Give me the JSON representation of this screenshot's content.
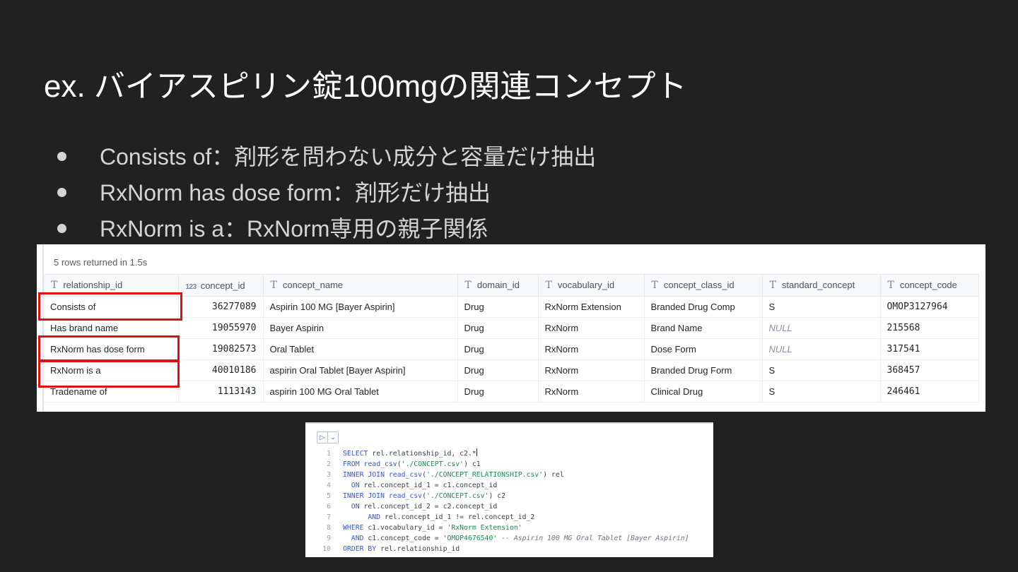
{
  "slide": {
    "title": "ex. バイアスピリン錠100mgの関連コンセプト",
    "bullets": [
      "Consists of：剤形を問わない成分と容量だけ抽出",
      "RxNorm has dose form：剤形だけ抽出",
      "RxNorm is a：RxNorm専用の親子関係"
    ]
  },
  "result": {
    "rows_returned": "5 rows returned in 1.5s",
    "columns": [
      {
        "type_icon": "T",
        "name": "relationship_id"
      },
      {
        "type_icon": "123",
        "name": "concept_id"
      },
      {
        "type_icon": "T",
        "name": "concept_name"
      },
      {
        "type_icon": "T",
        "name": "domain_id"
      },
      {
        "type_icon": "T",
        "name": "vocabulary_id"
      },
      {
        "type_icon": "T",
        "name": "concept_class_id"
      },
      {
        "type_icon": "T",
        "name": "standard_concept"
      },
      {
        "type_icon": "T",
        "name": "concept_code"
      }
    ],
    "rows": [
      {
        "relationship_id": "Consists of",
        "concept_id": "36277089",
        "concept_name": "Aspirin 100 MG [Bayer Aspirin]",
        "domain_id": "Drug",
        "vocabulary_id": "RxNorm Extension",
        "concept_class_id": "Branded Drug Comp",
        "standard_concept": "S",
        "concept_code": "OMOP3127964"
      },
      {
        "relationship_id": "Has brand name",
        "concept_id": "19055970",
        "concept_name": "Bayer Aspirin",
        "domain_id": "Drug",
        "vocabulary_id": "RxNorm",
        "concept_class_id": "Brand Name",
        "standard_concept": "NULL",
        "concept_code": "215568"
      },
      {
        "relationship_id": "RxNorm has dose form",
        "concept_id": "19082573",
        "concept_name": "Oral Tablet",
        "domain_id": "Drug",
        "vocabulary_id": "RxNorm",
        "concept_class_id": "Dose Form",
        "standard_concept": "NULL",
        "concept_code": "317541"
      },
      {
        "relationship_id": "RxNorm is a",
        "concept_id": "40010186",
        "concept_name": "aspirin Oral Tablet [Bayer Aspirin]",
        "domain_id": "Drug",
        "vocabulary_id": "RxNorm",
        "concept_class_id": "Branded Drug Form",
        "standard_concept": "S",
        "concept_code": "368457"
      },
      {
        "relationship_id": "Tradename of",
        "concept_id": "1113143",
        "concept_name": "aspirin 100 MG Oral Tablet",
        "domain_id": "Drug",
        "vocabulary_id": "RxNorm",
        "concept_class_id": "Clinical Drug",
        "standard_concept": "S",
        "concept_code": "246461"
      }
    ]
  },
  "sql_editor": {
    "run_icon": "run-triangle-icon",
    "dropdown_icon": "chevron-down-icon",
    "lines": [
      {
        "n": "1",
        "tokens": [
          [
            "kw",
            "SELECT"
          ],
          [
            "",
            "rel.relationship_id, c2.*"
          ]
        ],
        "caret": true
      },
      {
        "n": "2",
        "tokens": [
          [
            "kw",
            "FROM"
          ],
          [
            "",
            ""
          ],
          [
            "fn",
            "read_csv"
          ],
          [
            "",
            "("
          ],
          [
            "str",
            "'./CONCEPT.csv'"
          ],
          [
            "",
            ") c1"
          ]
        ]
      },
      {
        "n": "3",
        "tokens": [
          [
            "kw",
            "INNER JOIN"
          ],
          [
            "",
            ""
          ],
          [
            "fn",
            "read_csv"
          ],
          [
            "",
            "("
          ],
          [
            "str",
            "'./CONCEPT_RELATIONSHIP.csv'"
          ],
          [
            "",
            ") rel"
          ]
        ]
      },
      {
        "n": "4",
        "tokens": [
          [
            "",
            "  "
          ],
          [
            "kw",
            "ON"
          ],
          [
            "",
            "rel.concept_id_1 = c1.concept_id"
          ]
        ]
      },
      {
        "n": "5",
        "tokens": [
          [
            "kw",
            "INNER JOIN"
          ],
          [
            "",
            ""
          ],
          [
            "fn",
            "read_csv"
          ],
          [
            "",
            "("
          ],
          [
            "str",
            "'./CONCEPT.csv'"
          ],
          [
            "",
            ") c2"
          ]
        ]
      },
      {
        "n": "6",
        "tokens": [
          [
            "",
            "  "
          ],
          [
            "kw",
            "ON"
          ],
          [
            "",
            "rel.concept_id_2 = c2.concept_id"
          ]
        ]
      },
      {
        "n": "7",
        "tokens": [
          [
            "",
            "      "
          ],
          [
            "kw",
            "AND"
          ],
          [
            "",
            "rel.concept_id_1 != rel.concept_id_2"
          ]
        ]
      },
      {
        "n": "8",
        "tokens": [
          [
            "kw",
            "WHERE"
          ],
          [
            "",
            "c1.vocabulary_id = "
          ],
          [
            "str",
            "'RxNorm Extension'"
          ]
        ]
      },
      {
        "n": "9",
        "tokens": [
          [
            "",
            "  "
          ],
          [
            "kw",
            "AND"
          ],
          [
            "",
            "c1.concept_code = "
          ],
          [
            "str",
            "'OMOP4676540'"
          ],
          [
            "",
            " "
          ],
          [
            "cmt",
            "-- Aspirin 100 MG Oral Tablet [Bayer Aspirin]"
          ]
        ]
      },
      {
        "n": "10",
        "tokens": [
          [
            "kw",
            "ORDER BY"
          ],
          [
            "",
            "rel.relationship_id"
          ]
        ]
      }
    ]
  },
  "colors": {
    "background": "#212121",
    "highlight_box": "#e01010",
    "sql_keyword": "#3557d4",
    "sql_string": "#1f8a4c"
  }
}
